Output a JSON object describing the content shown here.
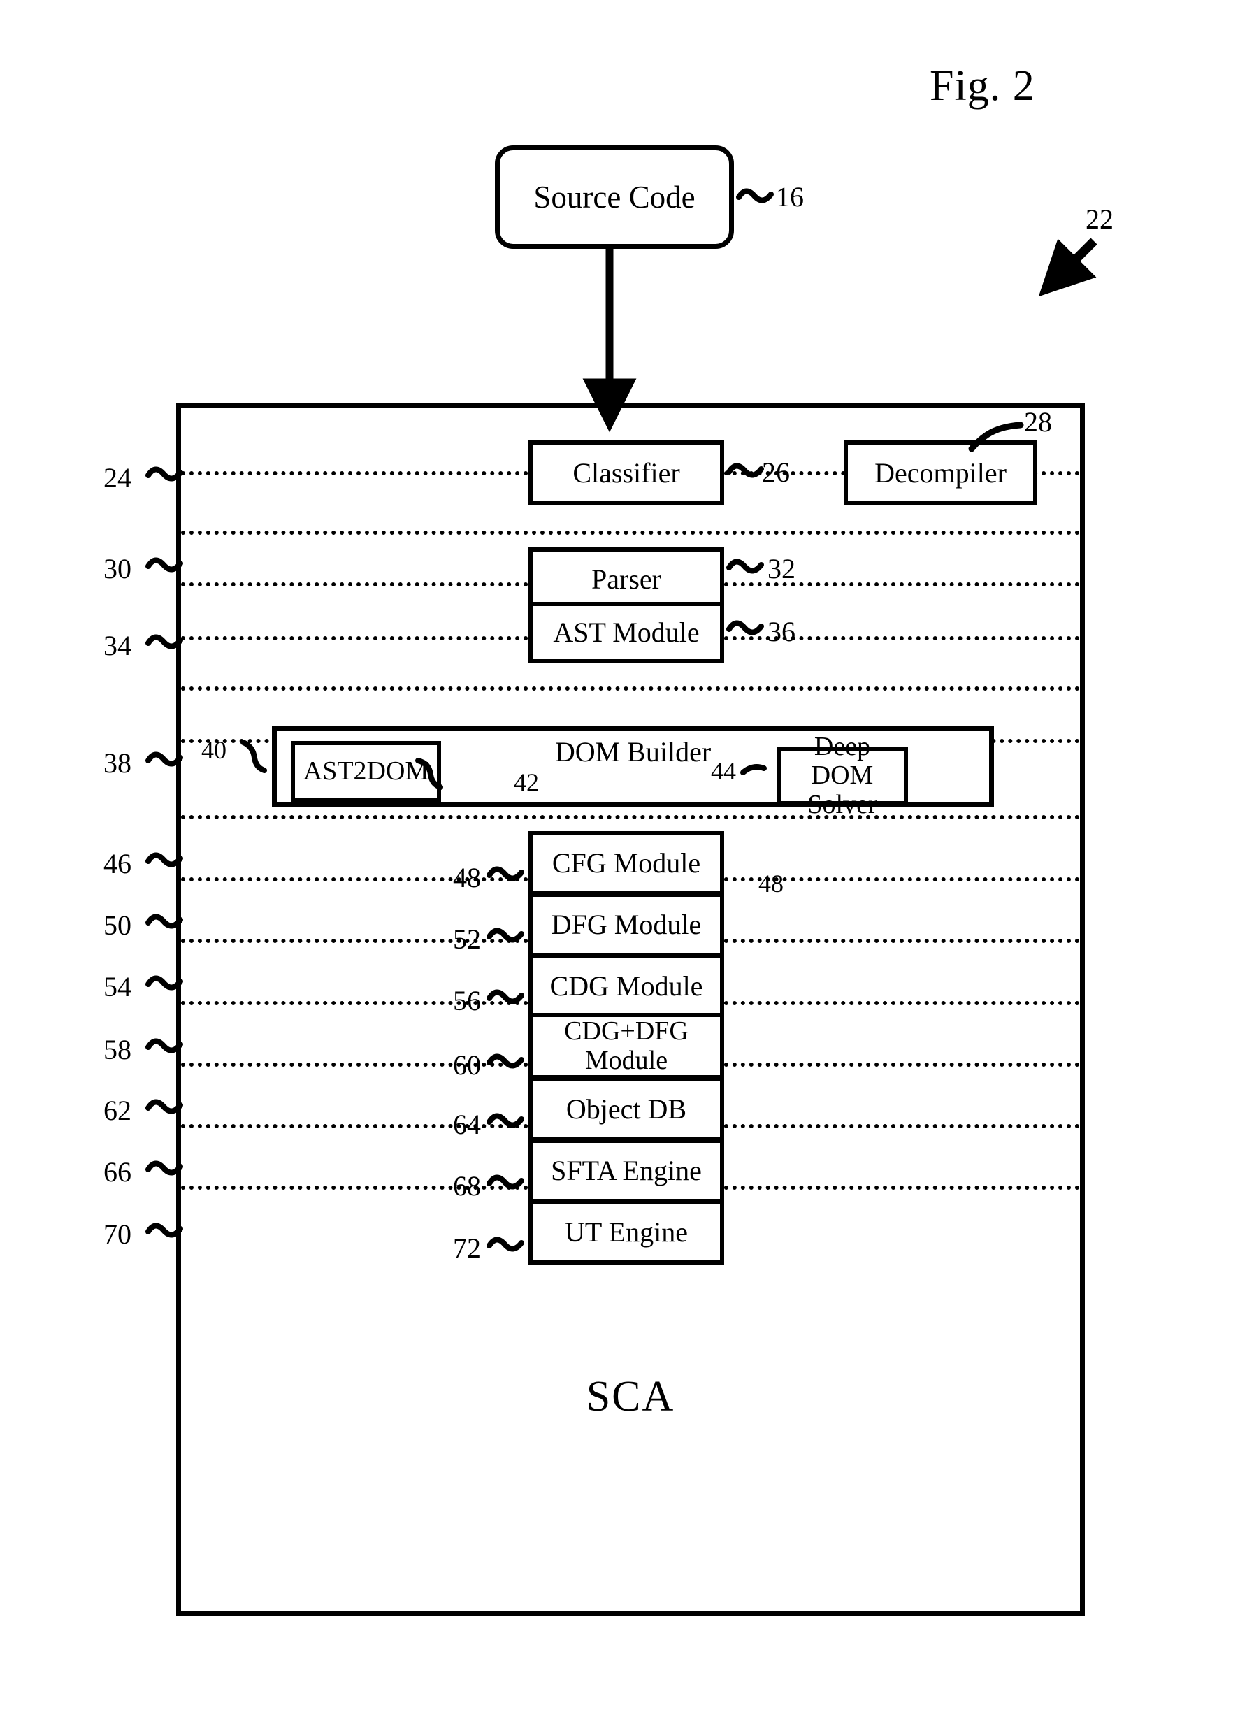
{
  "figure": {
    "title": "Fig. 2",
    "system_ref": "22",
    "container_caption": "SCA"
  },
  "source": {
    "label": "Source Code",
    "ref": "16"
  },
  "layers": [
    {
      "ref": "24",
      "boxes": [
        {
          "label": "Classifier",
          "ref": "26",
          "ref_side": "right"
        },
        {
          "label": "Decompiler",
          "ref": "28",
          "ref_side": "top-right"
        }
      ]
    },
    {
      "ref": "30",
      "boxes": [
        {
          "label": "Parser",
          "ref": "32",
          "ref_side": "right"
        }
      ]
    },
    {
      "ref": "34",
      "boxes": [
        {
          "label": "AST Module",
          "ref": "36",
          "ref_side": "right"
        }
      ]
    },
    {
      "ref": "38",
      "group": {
        "label": "DOM Builder",
        "ref": "40",
        "boxes": [
          {
            "label": "AST2DOM",
            "ref": "42",
            "ref_side": "right"
          },
          {
            "label": "Deep DOM Solver",
            "line1": "Deep DOM",
            "line2": "Solver",
            "ref": "44",
            "ref_side": "left"
          }
        ]
      }
    },
    {
      "ref": "46",
      "boxes": [
        {
          "label": "CFG Module",
          "ref": "48",
          "ref_side": "left"
        }
      ]
    },
    {
      "ref": "50",
      "boxes": [
        {
          "label": "DFG Module",
          "ref": "52",
          "ref_side": "left"
        }
      ]
    },
    {
      "ref": "54",
      "boxes": [
        {
          "label": "CDG Module",
          "ref": "56",
          "ref_side": "left"
        }
      ]
    },
    {
      "ref": "58",
      "boxes": [
        {
          "label": "CDG+DFG Module",
          "line1": "CDG+DFG",
          "line2": "Module",
          "ref": "60",
          "ref_side": "left"
        }
      ]
    },
    {
      "ref": "62",
      "boxes": [
        {
          "label": "Object DB",
          "ref": "64",
          "ref_side": "left"
        }
      ]
    },
    {
      "ref": "66",
      "boxes": [
        {
          "label": "SFTA Engine",
          "ref": "68",
          "ref_side": "left"
        }
      ]
    },
    {
      "ref": "70",
      "boxes": [
        {
          "label": "UT Engine",
          "ref": "72",
          "ref_side": "left"
        }
      ]
    }
  ],
  "refs": {
    "r16": "16",
    "r22": "22",
    "r24": "24",
    "r26": "26",
    "r28": "28",
    "r30": "30",
    "r32": "32",
    "r34": "34",
    "r36": "36",
    "r38": "38",
    "r40": "40",
    "r42": "42",
    "r44": "44",
    "r46": "46",
    "r48": "48",
    "r50": "50",
    "r52": "52",
    "r54": "54",
    "r56": "56",
    "r58": "58",
    "r60": "60",
    "r62": "62",
    "r64": "64",
    "r66": "66",
    "r68": "68",
    "r70": "70",
    "r72": "72"
  },
  "colors": {
    "ink": "#000000",
    "paper": "#ffffff"
  }
}
